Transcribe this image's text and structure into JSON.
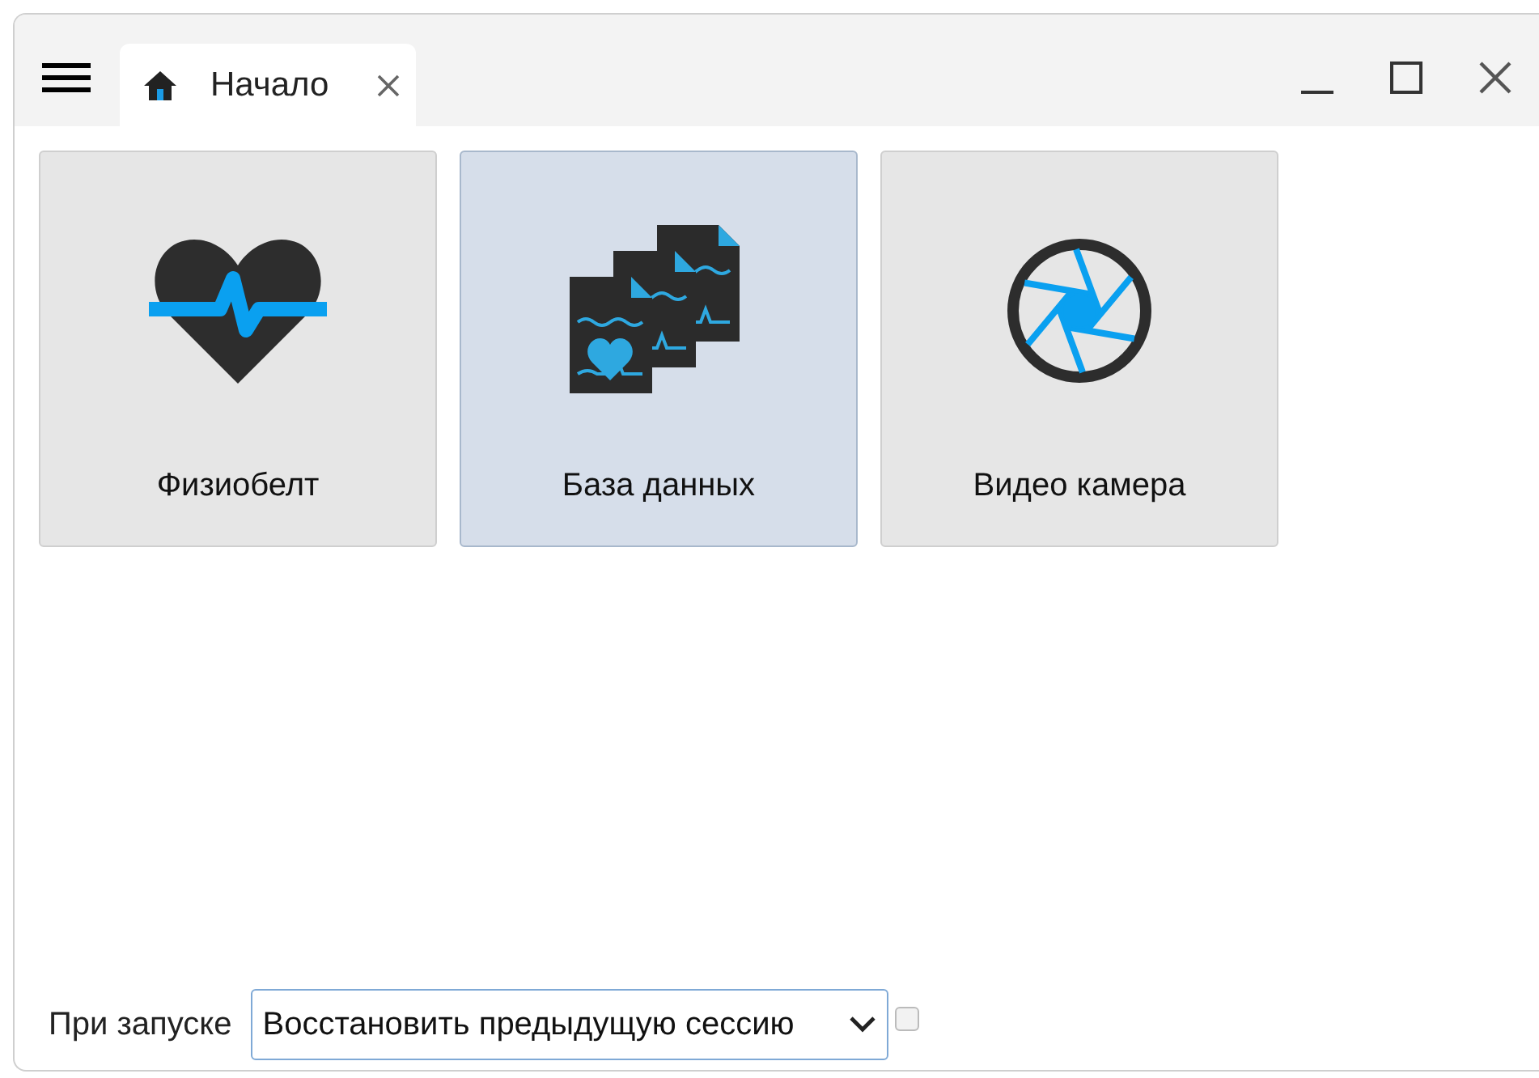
{
  "tabs": [
    {
      "label": "Начало",
      "selected": true
    }
  ],
  "tiles": [
    {
      "kind": "heart",
      "label": "Физиобелт",
      "selected": false
    },
    {
      "kind": "records",
      "label": "База данных",
      "selected": true
    },
    {
      "kind": "camera",
      "label": "Видео камера",
      "selected": false
    }
  ],
  "startup": {
    "label": "При запуске",
    "value": "Восстановить предыдущую сессию",
    "checked": false
  }
}
